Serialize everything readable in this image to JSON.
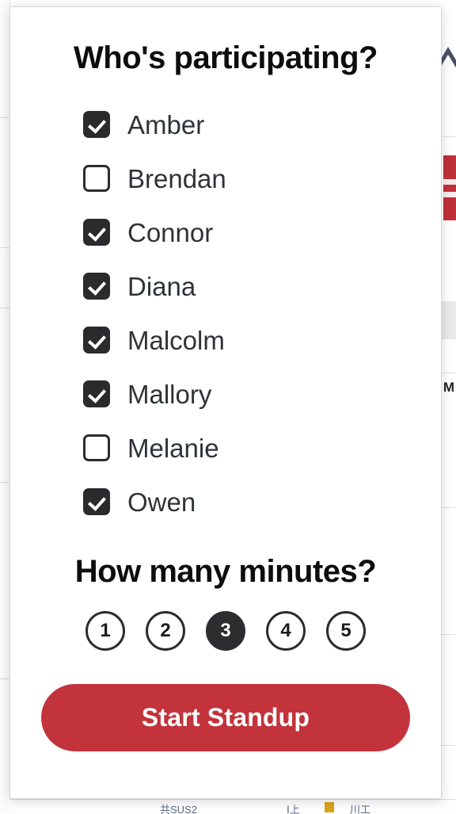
{
  "modal": {
    "participants_title": "Who's participating?",
    "participants": [
      {
        "name": "Amber",
        "checked": true,
        "icon": "checkbox-checked-icon"
      },
      {
        "name": "Brendan",
        "checked": false,
        "icon": "checkbox-unchecked-icon"
      },
      {
        "name": "Connor",
        "checked": true,
        "icon": "checkbox-checked-icon"
      },
      {
        "name": "Diana",
        "checked": true,
        "icon": "checkbox-checked-icon"
      },
      {
        "name": "Malcolm",
        "checked": true,
        "icon": "checkbox-checked-icon"
      },
      {
        "name": "Mallory",
        "checked": true,
        "icon": "checkbox-checked-icon"
      },
      {
        "name": "Melanie",
        "checked": false,
        "icon": "checkbox-unchecked-icon"
      },
      {
        "name": "Owen",
        "checked": true,
        "icon": "checkbox-checked-icon"
      }
    ],
    "minutes_title": "How many minutes?",
    "minutes_options": [
      "1",
      "2",
      "3",
      "4",
      "5"
    ],
    "minutes_selected": "3",
    "start_label": "Start Standup"
  },
  "colors": {
    "accent_red": "#c2333c",
    "selected_dark": "#2d2d30",
    "checkbox_dark": "#2b2b2e",
    "text_primary": "#0d0d0d",
    "text_name": "#2e3338",
    "card_background": "#ffffff",
    "page_background": "#f1f1f1"
  },
  "background": {
    "bottom_row_cells": [
      "共SUS2",
      "Ⅰ上",
      "川工"
    ],
    "right_glyph": "M"
  }
}
